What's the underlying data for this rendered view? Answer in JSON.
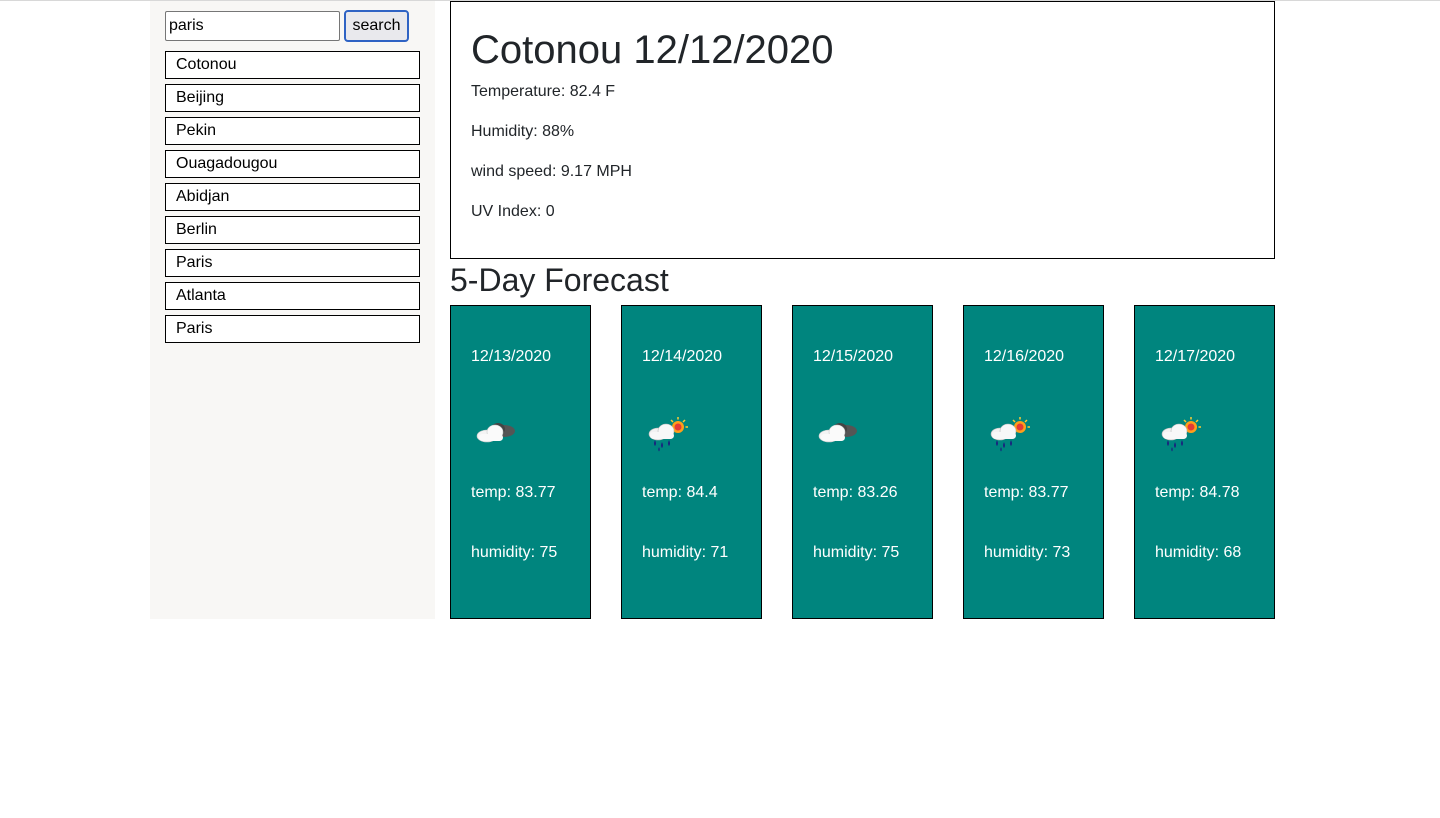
{
  "search": {
    "value": "paris",
    "button_label": "search"
  },
  "history": [
    "Cotonou",
    "Beijing",
    "Pekin",
    "Ouagadougou",
    "Abidjan",
    "Berlin",
    "Paris",
    "Atlanta",
    "Paris"
  ],
  "current": {
    "title": "Cotonou 12/12/2020",
    "temperature": "Temperature: 82.4 F",
    "humidity": "Humidity: 88%",
    "wind": "wind speed: 9.17 MPH",
    "uv": "UV Index: 0"
  },
  "forecast_title": "5-Day Forecast",
  "forecast": [
    {
      "date": "12/13/2020",
      "icon": "cloud-icon",
      "temp": "temp: 83.77",
      "humidity": "humidity: 75"
    },
    {
      "date": "12/14/2020",
      "icon": "rain-sun-icon",
      "temp": "temp: 84.4",
      "humidity": "humidity: 71"
    },
    {
      "date": "12/15/2020",
      "icon": "cloud-icon",
      "temp": "temp: 83.26",
      "humidity": "humidity: 75"
    },
    {
      "date": "12/16/2020",
      "icon": "rain-sun-icon",
      "temp": "temp: 83.77",
      "humidity": "humidity: 73"
    },
    {
      "date": "12/17/2020",
      "icon": "rain-sun-icon",
      "temp": "temp: 84.78",
      "humidity": "humidity: 68"
    }
  ],
  "colors": {
    "card_bg": "#00857e",
    "sidebar_bg": "#f8f7f5",
    "search_border": "#2f63c4"
  }
}
